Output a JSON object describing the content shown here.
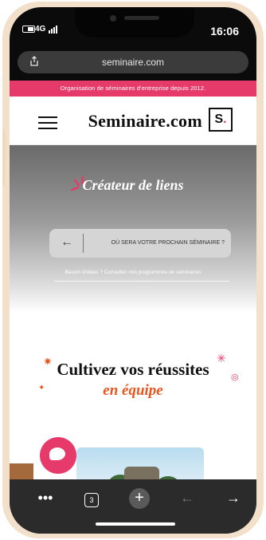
{
  "status": {
    "time": "16:06",
    "network": "4G"
  },
  "browser": {
    "url": "seminaire.com",
    "toolbar": {
      "more": "•••",
      "tabs_count": "3",
      "new_tab": "+",
      "back": "←",
      "forward": "→"
    }
  },
  "banner": {
    "text": "Organisation de séminaires d'entreprise depuis 2012."
  },
  "header": {
    "logo_mark": "S",
    "logo_dot": ".",
    "logo_text": "Seminaire.com"
  },
  "hero": {
    "title": "Créateur de liens",
    "search_placeholder": "OÙ SERA VOTRE PROCHAIN SÉMINAIRE ?",
    "hint": "Besoin d'idées ? Consultez nos programmes de séminaires"
  },
  "section": {
    "title": "Cultivez vos réussites",
    "subtitle": "en équipe"
  },
  "colors": {
    "brand_pink": "#e63a6b",
    "accent_orange": "#e8561f"
  },
  "icons": [
    "battery-icon",
    "signal-icon",
    "share-icon",
    "hamburger-menu-icon",
    "arrow-left-icon",
    "chat-icon",
    "sparkle-icon"
  ]
}
